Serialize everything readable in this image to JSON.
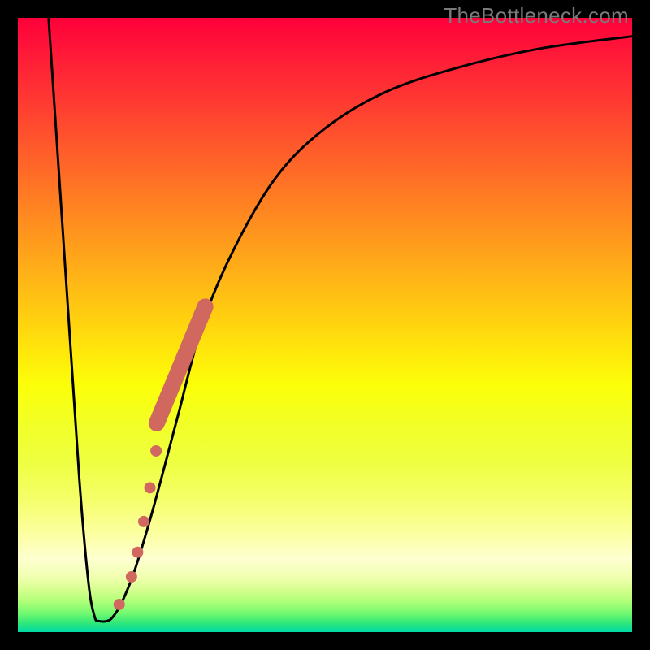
{
  "watermark": "TheBottleneck.com",
  "chart_data": {
    "type": "line",
    "title": "",
    "xlabel": "",
    "ylabel": "",
    "xlim": [
      0,
      100
    ],
    "ylim": [
      0,
      100
    ],
    "curve": [
      {
        "x": 5.0,
        "y": 100.0
      },
      {
        "x": 8.0,
        "y": 55.0
      },
      {
        "x": 10.0,
        "y": 25.0
      },
      {
        "x": 11.5,
        "y": 8.0
      },
      {
        "x": 12.5,
        "y": 2.5
      },
      {
        "x": 13.2,
        "y": 1.8
      },
      {
        "x": 14.5,
        "y": 1.8
      },
      {
        "x": 15.5,
        "y": 2.5
      },
      {
        "x": 17.0,
        "y": 5.0
      },
      {
        "x": 19.0,
        "y": 10.0
      },
      {
        "x": 22.0,
        "y": 20.0
      },
      {
        "x": 26.0,
        "y": 35.0
      },
      {
        "x": 30.0,
        "y": 50.0
      },
      {
        "x": 35.0,
        "y": 62.0
      },
      {
        "x": 42.0,
        "y": 74.0
      },
      {
        "x": 50.0,
        "y": 82.0
      },
      {
        "x": 60.0,
        "y": 88.0
      },
      {
        "x": 72.0,
        "y": 92.0
      },
      {
        "x": 85.0,
        "y": 95.0
      },
      {
        "x": 100.0,
        "y": 97.0
      }
    ],
    "highlight_segment": {
      "x0": 22.6,
      "y0": 34.0,
      "x1": 30.5,
      "y1": 53.0,
      "width": 10
    },
    "dots": [
      {
        "x": 16.5,
        "y": 4.5
      },
      {
        "x": 18.5,
        "y": 9.0
      },
      {
        "x": 19.5,
        "y": 13.0
      },
      {
        "x": 20.5,
        "y": 18.0
      },
      {
        "x": 21.5,
        "y": 23.5
      },
      {
        "x": 22.5,
        "y": 29.5
      }
    ],
    "dot_radius": 7,
    "marker_color": "#d1685f",
    "curve_color": "#000000"
  }
}
